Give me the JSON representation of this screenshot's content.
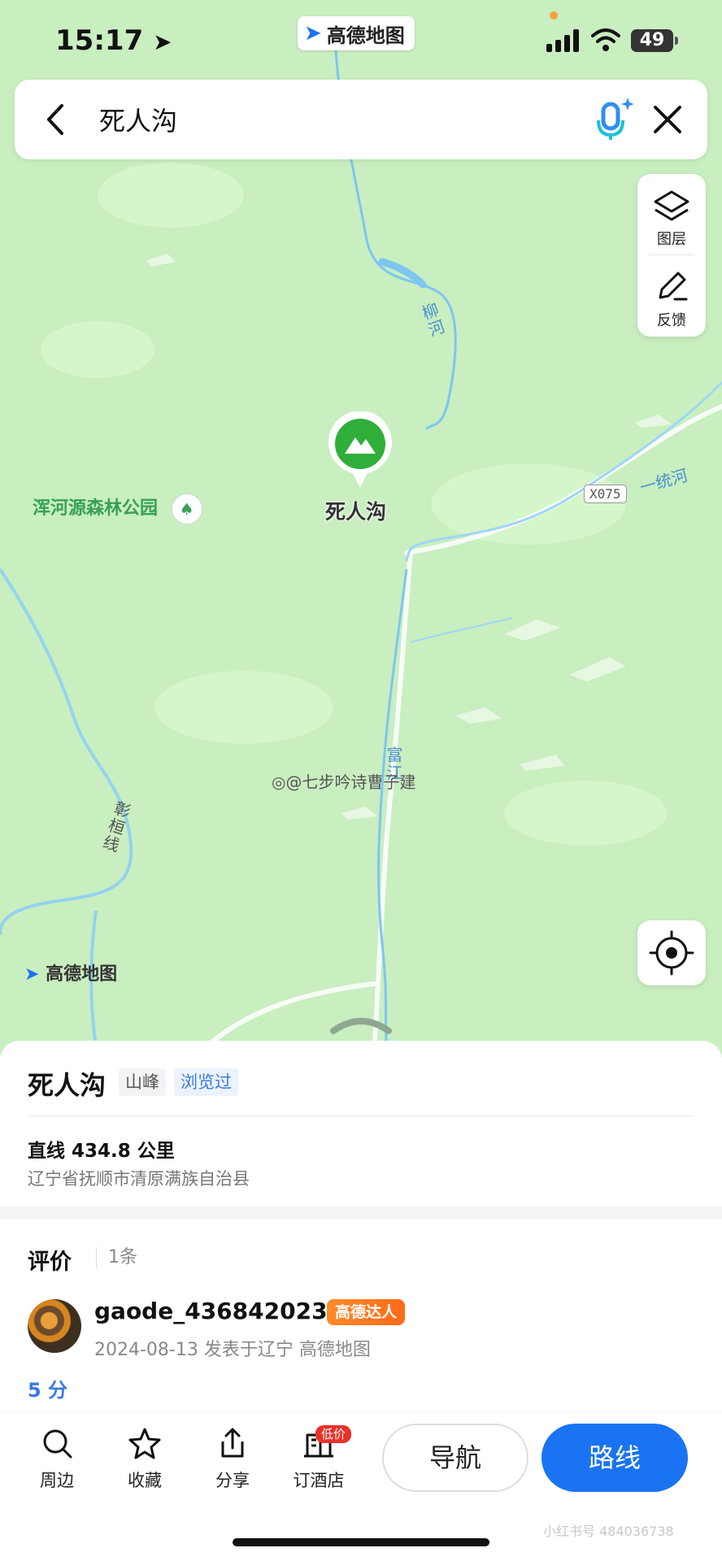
{
  "status_bar": {
    "time": "15:17",
    "battery": "49",
    "brand": "高德地图"
  },
  "search": {
    "query": "死人沟",
    "back_icon": "chevron-left-icon",
    "voice_icon": "microphone-icon",
    "close_icon": "close-icon"
  },
  "side_tools": [
    {
      "label": "图层",
      "icon": "layers-icon"
    },
    {
      "label": "反馈",
      "icon": "pencil-icon"
    }
  ],
  "map": {
    "poi_label": "死人沟",
    "park_label": "浑河源森林公园",
    "river_liu": "柳河",
    "river_yitong": "一统河",
    "road_badge": "X075",
    "river_fu": "富江",
    "road_zhanghuan": "彰桓线",
    "logo": "高德地图",
    "watermark": "@七步吟诗曹子建"
  },
  "place": {
    "name": "死人沟",
    "type_tag": "山峰",
    "viewed_tag": "浏览过",
    "distance": "直线 434.8 公里",
    "address": "辽宁省抚顺市清原满族自治县"
  },
  "reviews": {
    "title": "评价",
    "count": "1条",
    "username": "gaode_436842023",
    "badge": "高德达人",
    "meta": "2024-08-13 发表于辽宁  高德地图",
    "score": "5 分"
  },
  "actions": [
    {
      "label": "周边",
      "icon": "search-icon"
    },
    {
      "label": "收藏",
      "icon": "star-icon"
    },
    {
      "label": "分享",
      "icon": "share-icon"
    },
    {
      "label": "订酒店",
      "icon": "hotel-icon"
    }
  ],
  "hotel_badge": "低价",
  "buttons": {
    "navigate": "导航",
    "route": "路线"
  },
  "footer_watermark": "小红书号 484036738",
  "colors": {
    "map_bg": "#c9eec0",
    "river": "#7cc6f0",
    "accent": "#1a73f2",
    "poi_green": "#2fae3a",
    "badge_orange": "#ff7a22"
  }
}
